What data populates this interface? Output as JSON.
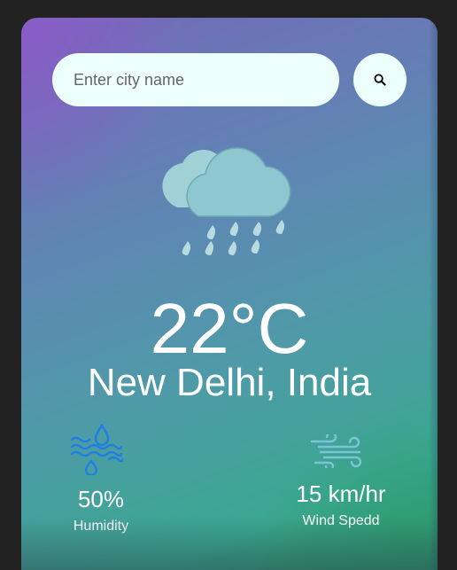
{
  "search": {
    "placeholder": "Enter city name",
    "value": "",
    "button_icon": "search-icon"
  },
  "weather": {
    "icon": "rain-cloud-icon",
    "temperature": "22°C",
    "city": "New Delhi, India"
  },
  "details": {
    "humidity": {
      "icon": "humidity-icon",
      "value": "50%",
      "label": "Humidity"
    },
    "wind": {
      "icon": "wind-icon",
      "value": "15 km/hr",
      "label": "Wind Spedd"
    }
  },
  "colors": {
    "page_background": "#222222",
    "input_background": "#ecfffa",
    "text": "#ffffff",
    "cloud": "#91c8d0",
    "humidity_icon": "#1e7ee6",
    "wind_icon": "#7cc3d8"
  }
}
